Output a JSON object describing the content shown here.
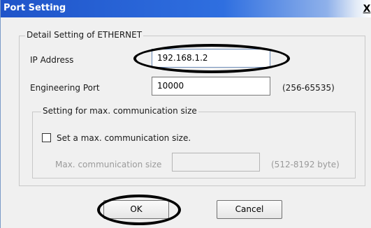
{
  "window": {
    "title": "Port Setting",
    "close_label": "X"
  },
  "ethernet_group": {
    "label": "Detail Setting of ETHERNET",
    "ip_label": "IP Address",
    "ip_value": "192.168.1.2",
    "port_label": "Engineering Port",
    "port_value": "10000",
    "port_range": "(256-65535)"
  },
  "comm_group": {
    "label": "Setting for max. communication size",
    "checkbox_label": "Set a max. communication size.",
    "checked": false,
    "size_label": "Max. communication size",
    "size_value": "",
    "size_range": "(512-8192 byte)"
  },
  "buttons": {
    "ok": "OK",
    "cancel": "Cancel"
  }
}
